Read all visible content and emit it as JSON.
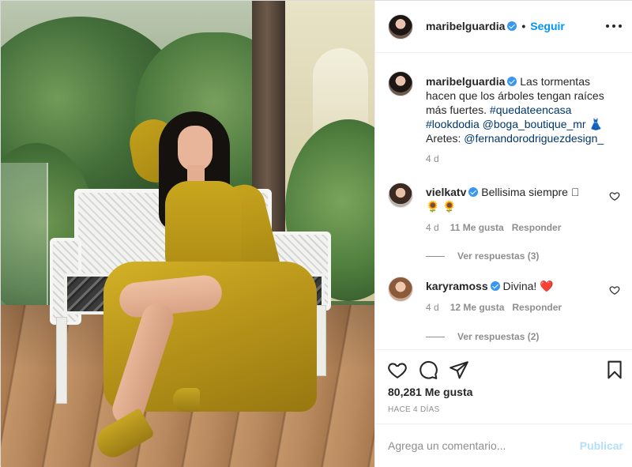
{
  "post": {
    "author": "maribelguardia",
    "follow_label": "Seguir",
    "separator": "•",
    "photo_alt": "Mujer con vestido dorado sentada en banca de mimbre blanca"
  },
  "caption": {
    "username": "maribelguardia",
    "text_plain": "Las tormentas hacen que los árboles tengan raíces más fuertes.",
    "hashtag1": "#quedateencasa",
    "hashtag2": "#lookdodia",
    "mention1": "@boga_boutique_mr",
    "emoji_dress": "👗",
    "earrings_label": "Aretes:",
    "mention2": "@fernandorodriguezdesign_",
    "age": "4 d"
  },
  "comments": [
    {
      "username": "vielkatv",
      "text": "Bellisima siempre 🏻",
      "emojis": "🌻 🌻",
      "age": "4 d",
      "likes": "11 Me gusta",
      "reply_label": "Responder",
      "view_replies": "Ver respuestas (3)"
    },
    {
      "username": "karyramoss",
      "text": "Divina! ❤️",
      "age": "4 d",
      "likes": "12 Me gusta",
      "reply_label": "Responder",
      "view_replies": "Ver respuestas (2)"
    }
  ],
  "actions": {
    "likes_count": "80,281 Me gusta",
    "time_ago": "HACE 4 DÍAS"
  },
  "composer": {
    "placeholder": "Agrega un comentario...",
    "publish_label": "Publicar"
  },
  "colors": {
    "link_blue": "#0095f6",
    "hashtag_blue": "#00376b",
    "muted_gray": "#8e8e8e",
    "heart_red": "#ed4956",
    "verified_blue": "#3897f0"
  }
}
